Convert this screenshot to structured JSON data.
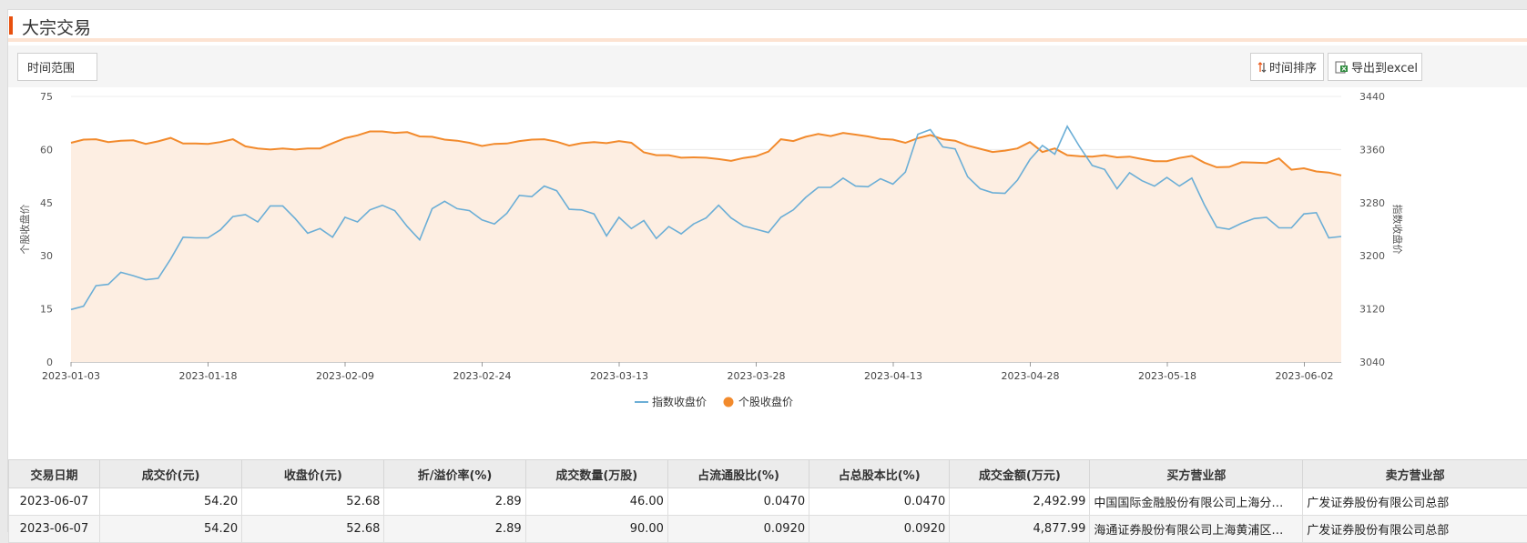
{
  "page": {
    "title": "大宗交易"
  },
  "toolbar": {
    "range_label": "时间范围",
    "sort_label": "时间排序",
    "excel_label": "导出到excel",
    "sort_icon": "sort-arrows-icon",
    "excel_icon": "excel-export-icon"
  },
  "colors": {
    "accent": "#e8500e",
    "index_line": "#6baed6",
    "stock_line": "#f28a2c",
    "area_fill": "#fdeee2"
  },
  "chart_data": {
    "type": "line",
    "x_axis": {
      "tick_labels": [
        "2023-01-03",
        "2023-01-18",
        "2023-02-09",
        "2023-02-24",
        "2023-03-13",
        "2023-03-28",
        "2023-04-13",
        "2023-04-28",
        "2023-05-18",
        "2023-06-02"
      ]
    },
    "y_left": {
      "label": "个股收盘价",
      "ticks": [
        0,
        15,
        30,
        45,
        60,
        75
      ],
      "ylim": [
        0,
        75
      ]
    },
    "y_right": {
      "label": "指数收盘价",
      "ticks": [
        3040,
        3120,
        3200,
        3280,
        3360,
        3440
      ],
      "ylim": [
        3040,
        3440
      ]
    },
    "legend": {
      "position": "bottom"
    },
    "grid": true,
    "series": [
      {
        "name": "指数收盘价",
        "axis": "right",
        "color": "#6baed6",
        "values": [
          3119,
          3124,
          3155,
          3157,
          3175,
          3170,
          3164,
          3166,
          3195,
          3228,
          3227,
          3227,
          3239,
          3259,
          3262,
          3251,
          3275,
          3275,
          3256,
          3234,
          3241,
          3228,
          3258,
          3251,
          3269,
          3276,
          3268,
          3244,
          3224,
          3271,
          3282,
          3271,
          3268,
          3254,
          3248,
          3264,
          3291,
          3289,
          3305,
          3298,
          3270,
          3269,
          3263,
          3230,
          3258,
          3241,
          3253,
          3226,
          3244,
          3233,
          3248,
          3257,
          3276,
          3257,
          3245,
          3240,
          3235,
          3258,
          3269,
          3288,
          3303,
          3303,
          3317,
          3305,
          3304,
          3316,
          3308,
          3326,
          3383,
          3390,
          3364,
          3361,
          3319,
          3301,
          3295,
          3294,
          3314,
          3345,
          3366,
          3353,
          3395,
          3364,
          3336,
          3330,
          3301,
          3325,
          3313,
          3305,
          3318,
          3305,
          3317,
          3277,
          3243,
          3240,
          3249,
          3256,
          3258,
          3242,
          3242,
          3263,
          3265,
          3227,
          3229
        ]
      },
      {
        "name": "个股收盘价",
        "axis": "left",
        "color": "#f28a2c",
        "values": [
          61.9,
          62.8,
          62.9,
          62.1,
          62.5,
          62.6,
          61.6,
          62.3,
          63.3,
          61.7,
          61.7,
          61.6,
          62.1,
          62.9,
          60.9,
          60.3,
          60.0,
          60.3,
          60.0,
          60.3,
          60.3,
          61.8,
          63.2,
          64.0,
          65.1,
          65.1,
          64.7,
          64.9,
          63.7,
          63.6,
          62.8,
          62.5,
          61.9,
          61.0,
          61.6,
          61.7,
          62.4,
          62.8,
          62.9,
          62.2,
          61.1,
          61.8,
          62.1,
          61.8,
          62.4,
          61.9,
          59.2,
          58.4,
          58.4,
          57.7,
          57.8,
          57.7,
          57.3,
          56.8,
          57.6,
          58.1,
          59.4,
          62.9,
          62.4,
          63.6,
          64.4,
          63.8,
          64.7,
          64.2,
          63.7,
          63.0,
          62.8,
          61.9,
          63.2,
          64.1,
          62.9,
          62.5,
          61.1,
          60.2,
          59.3,
          59.7,
          60.3,
          62.1,
          59.3,
          60.3,
          58.4,
          58.1,
          58.0,
          58.4,
          57.8,
          58.0,
          57.3,
          56.7,
          56.7,
          57.6,
          58.2,
          56.3,
          55.0,
          55.1,
          56.4,
          56.3,
          56.2,
          57.5,
          54.3,
          54.7,
          53.8,
          53.5,
          52.7
        ]
      }
    ]
  },
  "table": {
    "headers": [
      "交易日期",
      "成交价(元)",
      "收盘价(元)",
      "折/溢价率(%)",
      "成交数量(万股)",
      "占流通股比(%)",
      "占总股本比(%)",
      "成交金额(万元)",
      "买方营业部",
      "卖方营业部"
    ],
    "rows": [
      [
        "2023-06-07",
        "54.20",
        "52.68",
        "2.89",
        "46.00",
        "0.0470",
        "0.0470",
        "2,492.99",
        "中国国际金融股份有限公司上海分…",
        "广发证券股份有限公司总部"
      ],
      [
        "2023-06-07",
        "54.20",
        "52.68",
        "2.89",
        "90.00",
        "0.0920",
        "0.0920",
        "4,877.99",
        "海通证券股份有限公司上海黄浦区…",
        "广发证券股份有限公司总部"
      ]
    ]
  }
}
